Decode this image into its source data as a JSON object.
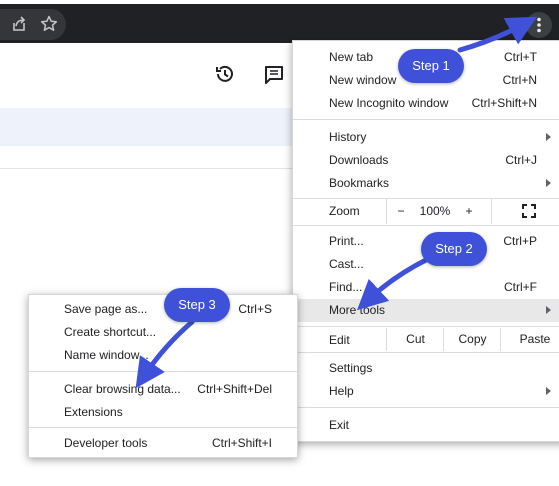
{
  "menu": {
    "items": [
      {
        "label": "New tab",
        "shortcut": "Ctrl+T"
      },
      {
        "label": "New window",
        "shortcut": "Ctrl+N"
      },
      {
        "label": "New Incognito window",
        "shortcut": "Ctrl+Shift+N"
      },
      {
        "label": "History"
      },
      {
        "label": "Downloads",
        "shortcut": "Ctrl+J"
      },
      {
        "label": "Bookmarks"
      },
      {
        "label": "Print...",
        "shortcut": "Ctrl+P"
      },
      {
        "label": "Cast..."
      },
      {
        "label": "Find...",
        "shortcut": "Ctrl+F"
      },
      {
        "label": "More tools"
      },
      {
        "label": "Settings"
      },
      {
        "label": "Help"
      },
      {
        "label": "Exit"
      }
    ],
    "zoom": {
      "label": "Zoom",
      "minus": "−",
      "value": "100%",
      "plus": "+"
    },
    "edit": {
      "label": "Edit",
      "cut": "Cut",
      "copy": "Copy",
      "paste": "Paste"
    }
  },
  "submenu": {
    "items": [
      {
        "label": "Save page as...",
        "shortcut": "Ctrl+S"
      },
      {
        "label": "Create shortcut..."
      },
      {
        "label": "Name window..."
      },
      {
        "label": "Clear browsing data...",
        "shortcut": "Ctrl+Shift+Del"
      },
      {
        "label": "Extensions"
      },
      {
        "label": "Developer tools",
        "shortcut": "Ctrl+Shift+I"
      }
    ]
  },
  "callouts": {
    "step1": "Step 1",
    "step2": "Step 2",
    "step3": "Step 3"
  },
  "colors": {
    "callout": "#3f51d8",
    "highlight": "#e8e8e8",
    "chrome": "#202124"
  },
  "icons": [
    "share-icon",
    "star-icon",
    "kebab-menu-icon",
    "history-icon",
    "chat-icon",
    "fullscreen-icon",
    "submenu-arrow-icon"
  ]
}
